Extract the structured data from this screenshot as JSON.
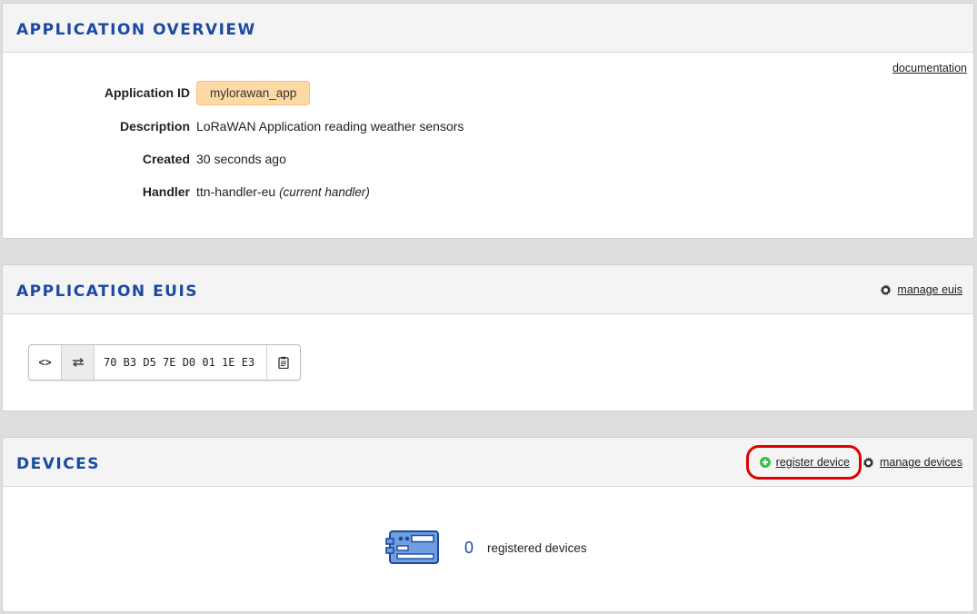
{
  "overview": {
    "title": "APPLICATION OVERVIEW",
    "documentation_link": "documentation",
    "rows": [
      {
        "key": "Application ID",
        "value": "mylorawan_app"
      },
      {
        "key": "Description",
        "value": "LoRaWAN Application reading weather sensors"
      },
      {
        "key": "Created",
        "value": "30 seconds ago"
      },
      {
        "key": "Handler",
        "value": "ttn-handler-eu",
        "note": "(current handler)"
      }
    ]
  },
  "euis": {
    "title": "APPLICATION EUIS",
    "manage_label": "manage euis",
    "code_toggle_label": "<>",
    "swap_icon": "swap-icon",
    "value": "70 B3 D5 7E D0 01 1E E3",
    "copy_icon": "clipboard-icon"
  },
  "devices": {
    "title": "DEVICES",
    "register_label": "register device",
    "manage_label": "manage devices",
    "count": "0",
    "count_label": "registered devices"
  },
  "colors": {
    "title": "#1b4aa0",
    "badge_bg": "#fdd9a6",
    "register_icon": "#3fbf4a",
    "highlight": "#e00000"
  }
}
